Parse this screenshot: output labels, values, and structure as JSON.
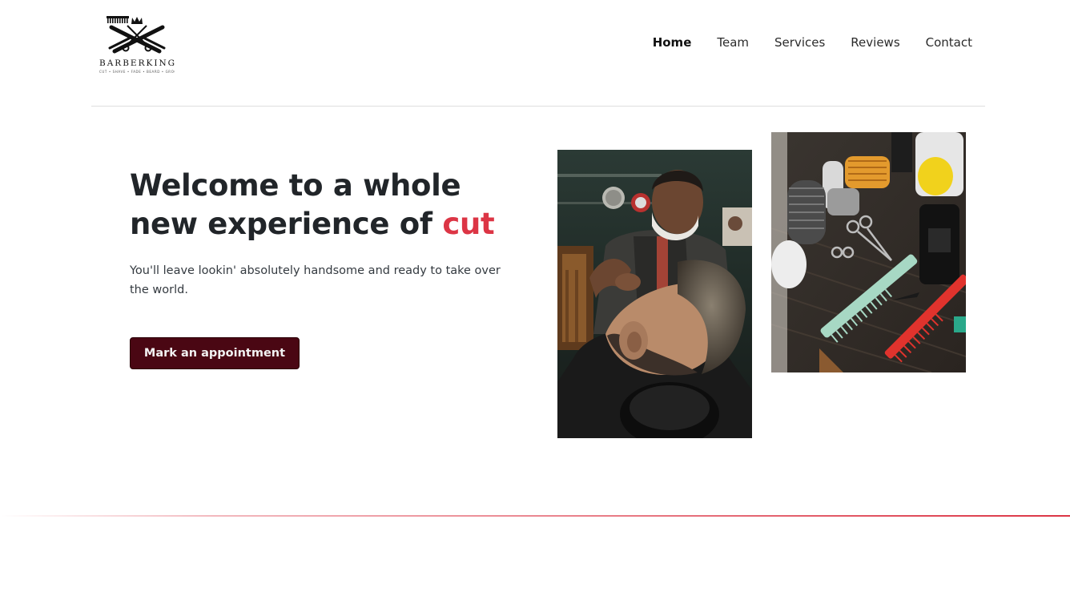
{
  "brand": {
    "name": "BARBERKING",
    "tagline": "CUT • SHAVE • FADE • BEARD • GROOM"
  },
  "nav": {
    "items": [
      {
        "label": "Home",
        "active": true
      },
      {
        "label": "Team",
        "active": false
      },
      {
        "label": "Services",
        "active": false
      },
      {
        "label": "Reviews",
        "active": false
      },
      {
        "label": "Contact",
        "active": false
      }
    ]
  },
  "hero": {
    "title_line1": "Welcome to a whole",
    "title_line2": "new experience of",
    "title_accent": "cut",
    "description": "You'll leave lookin' absolutely handsome and ready to take over the world.",
    "cta_label": "Mark an appointment"
  },
  "colors": {
    "accent": "#dc3545",
    "cta_background": "#4a0713",
    "text": "#212529"
  },
  "images": [
    {
      "name": "barber-trimming-beard-photo"
    },
    {
      "name": "barber-tools-flatlay-photo"
    }
  ]
}
